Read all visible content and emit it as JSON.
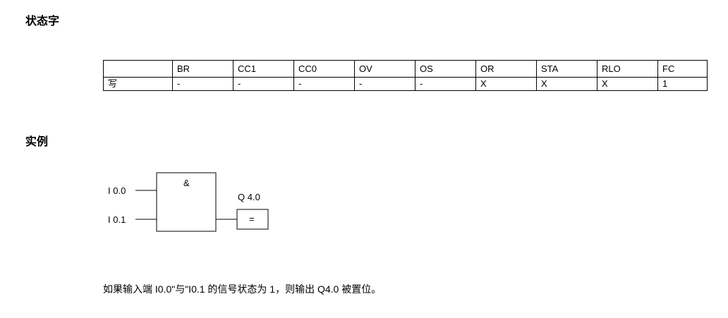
{
  "headings": {
    "status_word": "状态字",
    "example": "实例"
  },
  "status_table": {
    "columns": [
      "",
      "BR",
      "CC1",
      "CC0",
      "OV",
      "OS",
      "OR",
      "STA",
      "RLO",
      "FC"
    ],
    "rows": [
      [
        "写",
        "-",
        "-",
        "-",
        "-",
        "-",
        "X",
        "X",
        "X",
        "1"
      ]
    ]
  },
  "diagram": {
    "gate_symbol": "&",
    "input_1": "I 0.0",
    "input_2": "I 0.1",
    "output_label": "Q 4.0",
    "assign_symbol": "="
  },
  "description": "如果输入端 I0.0\"与\"I0.1 的信号状态为 1，则输出 Q4.0 被置位。"
}
